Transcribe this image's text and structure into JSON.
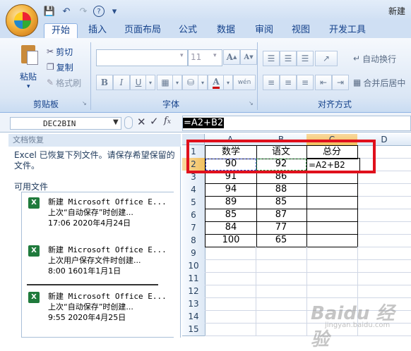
{
  "window": {
    "title": "新建"
  },
  "tabs": [
    "开始",
    "插入",
    "页面布局",
    "公式",
    "数据",
    "审阅",
    "视图",
    "开发工具"
  ],
  "ribbon": {
    "paste_label": "粘贴",
    "cut_label": "剪切",
    "copy_label": "复制",
    "format_painter_label": "格式刷",
    "clipboard_group": "剪贴板",
    "font_size": "11",
    "font_group": "字体",
    "wrap_text_label": "自动换行",
    "merge_center_label": "合并后居中",
    "alignment_group": "对齐方式"
  },
  "formula_bar": {
    "name_box": "DEC2BIN",
    "formula": "=A2+B2"
  },
  "recovery_pane": {
    "title": "文档恢复",
    "message": "Excel 已恢复下列文件。请保存希望保留的文件。",
    "available_label": "可用文件",
    "items": [
      {
        "name": "新建 Microsoft Office E...",
        "line2": "上次“自动保存”时创建...",
        "line3": "17:06 2020年4月24日"
      },
      {
        "name": "新建 Microsoft Office E...",
        "line2": "上次用户保存文件时创建...",
        "line3": "8:00 1601年1月1日"
      },
      {
        "name": "新建 Microsoft Office E...",
        "line2": "上次“自动保存”时创建...",
        "line3": "9:55 2020年4月25日"
      }
    ]
  },
  "sheet": {
    "columns": [
      "A",
      "B",
      "C",
      "D"
    ],
    "rows": [
      "1",
      "2",
      "3",
      "4",
      "5",
      "6",
      "7",
      "8",
      "9",
      "10",
      "11",
      "12",
      "13",
      "14",
      "15"
    ],
    "table": [
      [
        "数学",
        "语文",
        "总分"
      ],
      [
        "90",
        "92",
        "=A2+B2"
      ],
      [
        "91",
        "86",
        ""
      ],
      [
        "94",
        "88",
        ""
      ],
      [
        "89",
        "85",
        ""
      ],
      [
        "85",
        "87",
        ""
      ],
      [
        "84",
        "77",
        ""
      ],
      [
        "100",
        "65",
        ""
      ]
    ]
  },
  "watermark": {
    "text": "Baidu 经验",
    "sub": "jingyan.baidu.com"
  }
}
